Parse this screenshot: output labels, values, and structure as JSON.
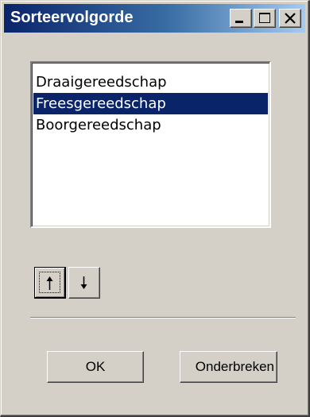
{
  "window": {
    "title": "Sorteervolgorde"
  },
  "titlebar_buttons": {
    "minimize": "minimize-icon",
    "maximize": "maximize-icon",
    "close": "close-icon"
  },
  "colors": {
    "titlebar_start": "#0a246a",
    "titlebar_end": "#a6caf0",
    "selection": "#0a246a",
    "face": "#d4d0c8"
  },
  "list": {
    "items": [
      {
        "label": "Draaigereedschap",
        "selected": false
      },
      {
        "label": "Freesgereedschap",
        "selected": true
      },
      {
        "label": "Boorgereedschap",
        "selected": false
      }
    ]
  },
  "order_buttons": {
    "up_icon": "arrow-up-icon",
    "down_icon": "arrow-down-icon"
  },
  "footer": {
    "ok_label": "OK",
    "cancel_label": "Onderbreken"
  }
}
